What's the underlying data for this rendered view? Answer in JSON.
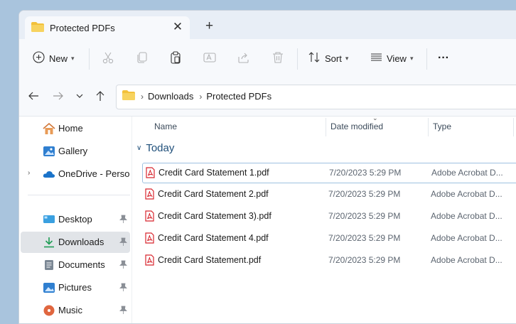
{
  "tab": {
    "title": "Protected PDFs",
    "close_glyph": "✕",
    "new_glyph": "+"
  },
  "toolbar": {
    "new_label": "New",
    "sort_label": "Sort",
    "view_label": "View",
    "more_glyph": "···"
  },
  "address": {
    "crumbs": [
      "Downloads",
      "Protected PDFs"
    ],
    "sep": "›"
  },
  "sidebar": {
    "items": [
      {
        "label": "Home",
        "icon": "home-icon"
      },
      {
        "label": "Gallery",
        "icon": "gallery-icon"
      },
      {
        "label": "OneDrive - Personal",
        "icon": "onedrive-icon",
        "expand": "›"
      },
      {
        "label": "Desktop",
        "icon": "desktop-icon"
      },
      {
        "label": "Downloads",
        "icon": "downloads-icon"
      },
      {
        "label": "Documents",
        "icon": "documents-icon"
      },
      {
        "label": "Pictures",
        "icon": "pictures-icon"
      },
      {
        "label": "Music",
        "icon": "music-icon"
      }
    ]
  },
  "columns": {
    "name": "Name",
    "date": "Date modified",
    "type": "Type"
  },
  "group": {
    "label": "Today",
    "chev": "∨"
  },
  "files": [
    {
      "name": "Credit Card Statement 1.pdf",
      "date": "7/20/2023 5:29 PM",
      "type": "Adobe Acrobat D..."
    },
    {
      "name": "Credit Card Statement 2.pdf",
      "date": "7/20/2023 5:29 PM",
      "type": "Adobe Acrobat D..."
    },
    {
      "name": "Credit Card Statement 3).pdf",
      "date": "7/20/2023 5:29 PM",
      "type": "Adobe Acrobat D..."
    },
    {
      "name": "Credit Card Statement 4.pdf",
      "date": "7/20/2023 5:29 PM",
      "type": "Adobe Acrobat D..."
    },
    {
      "name": "Credit Card Statement.pdf",
      "date": "7/20/2023 5:29 PM",
      "type": "Adobe Acrobat D..."
    }
  ],
  "colors": {
    "folder": "#f2c13b",
    "pdf": "#d8262e",
    "accent": "#0067c0",
    "selected_bg": "#e1e4e8"
  }
}
